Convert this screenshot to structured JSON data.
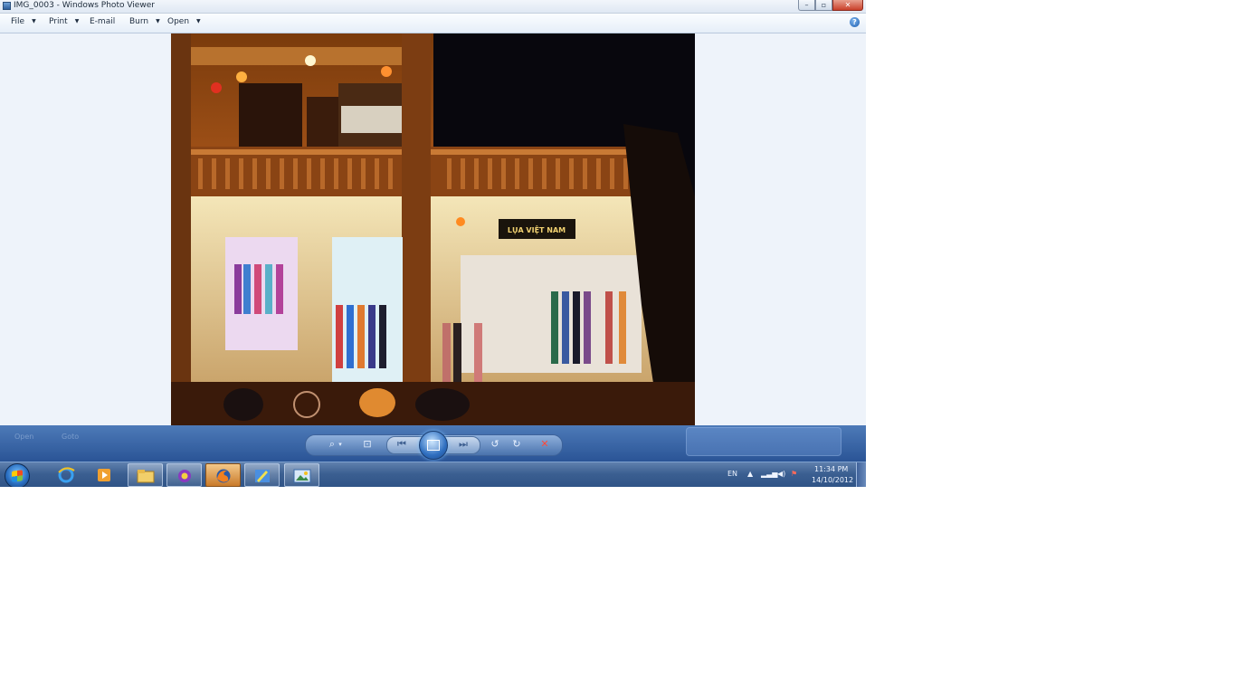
{
  "window": {
    "title": "IMG_0003 - Windows Photo Viewer",
    "buttons": {
      "minimize": "–",
      "maximize": "▫",
      "close": "✕"
    }
  },
  "menu": {
    "items": [
      {
        "label": "File"
      },
      {
        "label": "Print"
      },
      {
        "label": "E-mail"
      },
      {
        "label": "Burn"
      },
      {
        "label": "Open"
      }
    ],
    "help_icon": "help-icon"
  },
  "photo": {
    "sign_text": "LỤA VIỆT NAM"
  },
  "controls": {
    "ghost_labels": [
      "Open",
      "Goto"
    ],
    "buttons": [
      "zoom-icon",
      "actual-size-icon",
      "previous-icon",
      "slideshow-icon",
      "next-icon",
      "rotate-ccw-icon",
      "rotate-cw-icon",
      "delete-icon"
    ]
  },
  "taskbar": {
    "language": "EN",
    "time": "11:34 PM",
    "date": "14/10/2012",
    "apps": [
      "internet-explorer-icon",
      "media-player-icon",
      "file-explorer-icon",
      "messenger-icon",
      "firefox-icon",
      "paint-icon",
      "photo-viewer-icon"
    ]
  },
  "colors": {
    "accent": "#2a5496",
    "close": "#c9402a",
    "viewer_bg": "#eef3fa"
  }
}
